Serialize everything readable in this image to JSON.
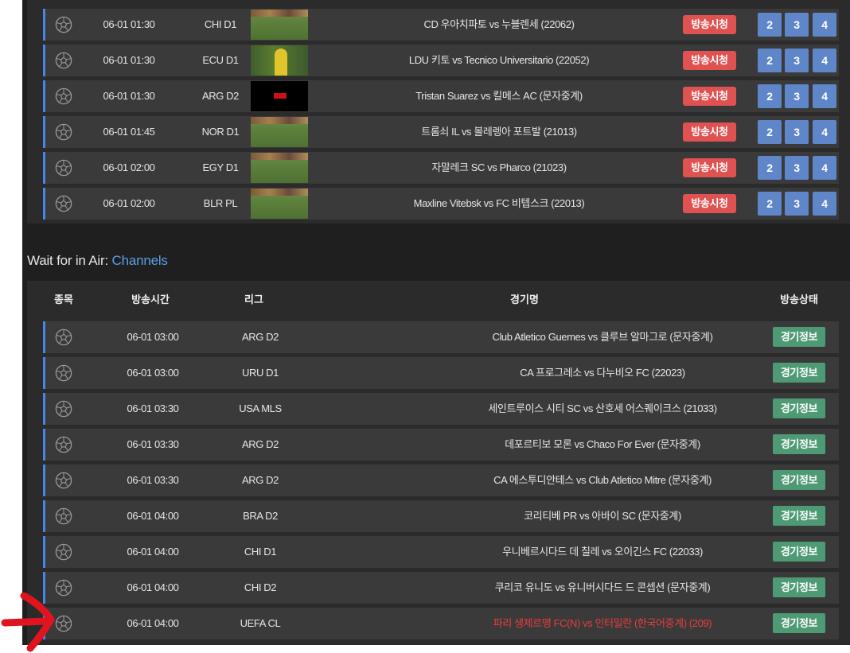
{
  "live_rows": [
    {
      "time": "06-01 01:30",
      "league": "CHI D1",
      "thumb": "pitch",
      "match": "CD 우아치파토 vs 누블렌세 (22062)",
      "watch": "방송시청",
      "channels": [
        "2",
        "3",
        "4"
      ]
    },
    {
      "time": "06-01 01:30",
      "league": "ECU D1",
      "thumb": "ldu",
      "match": "LDU 키토 vs Tecnico Universitario (22052)",
      "watch": "방송시청",
      "channels": [
        "2",
        "3",
        "4"
      ]
    },
    {
      "time": "06-01 01:30",
      "league": "ARG D2",
      "thumb": "black",
      "match": "Tristan Suarez vs 킬메스 AC (문자중계)",
      "watch": "방송시청",
      "channels": [
        "2",
        "3",
        "4"
      ]
    },
    {
      "time": "06-01 01:45",
      "league": "NOR D1",
      "thumb": "pitch",
      "match": "트롬쇠 IL vs 볼레렝아 포트발 (21013)",
      "watch": "방송시청",
      "channels": [
        "2",
        "3",
        "4"
      ]
    },
    {
      "time": "06-01 02:00",
      "league": "EGY D1",
      "thumb": "pitch",
      "match": "자말레크 SC vs Pharco (21023)",
      "watch": "방송시청",
      "channels": [
        "2",
        "3",
        "4"
      ]
    },
    {
      "time": "06-01 02:00",
      "league": "BLR PL",
      "thumb": "pitch",
      "match": "Maxline Vitebsk vs FC 비텝스크 (22013)",
      "watch": "방송시청",
      "channels": [
        "2",
        "3",
        "4"
      ]
    }
  ],
  "wait": {
    "title_prefix": "Wait for in Air: ",
    "title_link": "Channels",
    "headers": {
      "sport": "종목",
      "time": "방송시간",
      "league": "리그",
      "match": "경기명",
      "status": "방송상태"
    },
    "rows": [
      {
        "time": "06-01 03:00",
        "league": "ARG D2",
        "match": "Club Atletico Guemes vs 클루브 알마그로 (문자중계)",
        "status": "경기정보"
      },
      {
        "time": "06-01 03:00",
        "league": "URU D1",
        "match": "CA 프로그레소 vs 다누비오 FC (22023)",
        "status": "경기정보"
      },
      {
        "time": "06-01 03:30",
        "league": "USA MLS",
        "match": "세인트루이스 시티 SC vs 산호세 어스퀘이크스 (21033)",
        "status": "경기정보"
      },
      {
        "time": "06-01 03:30",
        "league": "ARG D2",
        "match": "데포르티보 모론 vs Chaco For Ever (문자중계)",
        "status": "경기정보"
      },
      {
        "time": "06-01 03:30",
        "league": "ARG D2",
        "match": "CA 에스투디안테스 vs Club Atletico Mitre (문자중계)",
        "status": "경기정보"
      },
      {
        "time": "06-01 04:00",
        "league": "BRA D2",
        "match": "코리티베 PR vs 아바이 SC (문자중계)",
        "status": "경기정보"
      },
      {
        "time": "06-01 04:00",
        "league": "CHI D1",
        "match": "우니베르시다드 데 칠레 vs 오이긴스 FC (22033)",
        "status": "경기정보"
      },
      {
        "time": "06-01 04:00",
        "league": "CHI D2",
        "match": "쿠리코 유니도 vs 유니버시다드 드 콘셉션 (문자중계)",
        "status": "경기정보"
      },
      {
        "time": "06-01 04:00",
        "league": "UEFA CL",
        "match": "파리 생제르맹 FC(N) vs 인터밀란 (한국어중계) (209)",
        "status": "경기정보",
        "highlight": true
      }
    ]
  },
  "colors": {
    "accent": "#4a86e8",
    "watch_button": "#e05151",
    "channel_button": "#5f86c9",
    "info_button": "#4e9a74",
    "highlight_text": "#e83d3d",
    "annotation_arrow": "#e0141e"
  },
  "icons": {
    "sport": "soccer-ball-icon",
    "annotation": "red-arrow-annotation"
  }
}
